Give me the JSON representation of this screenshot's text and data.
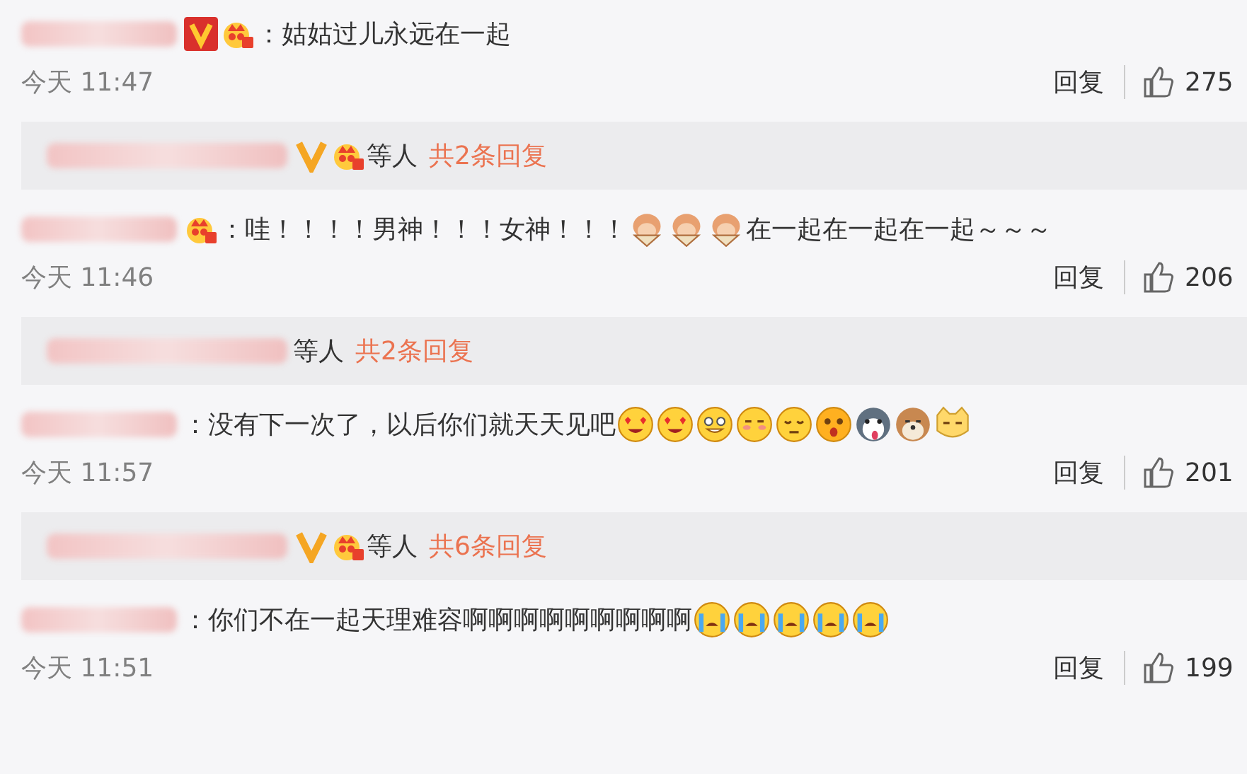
{
  "comments": [
    {
      "badges": [
        {
          "kind": "v-square"
        },
        {
          "kind": "crown"
        }
      ],
      "text": "：姑姑过儿永远在一起",
      "time": "今天 11:47",
      "reply": "回复",
      "likes": "275",
      "thread": {
        "badges": [
          {
            "kind": "v"
          },
          {
            "kind": "crown"
          }
        ],
        "others": "等人",
        "count": "共2条回复"
      }
    },
    {
      "badges": [
        {
          "kind": "crown"
        }
      ],
      "text": "：哇！！！！男神！！！女神！！！",
      "emojis": [
        {
          "kind": "monkey"
        },
        {
          "kind": "monkey"
        },
        {
          "kind": "monkey"
        }
      ],
      "tail": "在一起在一起在一起～～～",
      "time": "今天 11:46",
      "reply": "回复",
      "likes": "206",
      "thread": {
        "others": "等人",
        "count": "共2条回复"
      }
    },
    {
      "text": "：没有下一次了，以后你们就天天见吧",
      "emojis": [
        {
          "kind": "heart-eyes"
        },
        {
          "kind": "heart-eyes"
        },
        {
          "kind": "grin"
        },
        {
          "kind": "blush"
        },
        {
          "kind": "sleepy"
        },
        {
          "kind": "surprised"
        },
        {
          "kind": "husky"
        },
        {
          "kind": "dog"
        },
        {
          "kind": "cat"
        }
      ],
      "time": "今天 11:57",
      "reply": "回复",
      "likes": "201",
      "thread": {
        "badges": [
          {
            "kind": "v"
          },
          {
            "kind": "crown"
          }
        ],
        "others": "等人",
        "count": "共6条回复"
      }
    },
    {
      "text": "：你们不在一起天理难容啊啊啊啊啊啊啊啊啊",
      "emojis": [
        {
          "kind": "crying"
        },
        {
          "kind": "crying"
        },
        {
          "kind": "crying"
        },
        {
          "kind": "crying"
        },
        {
          "kind": "crying"
        }
      ],
      "time": "今天 11:51",
      "reply": "回复",
      "likes": "199"
    }
  ]
}
